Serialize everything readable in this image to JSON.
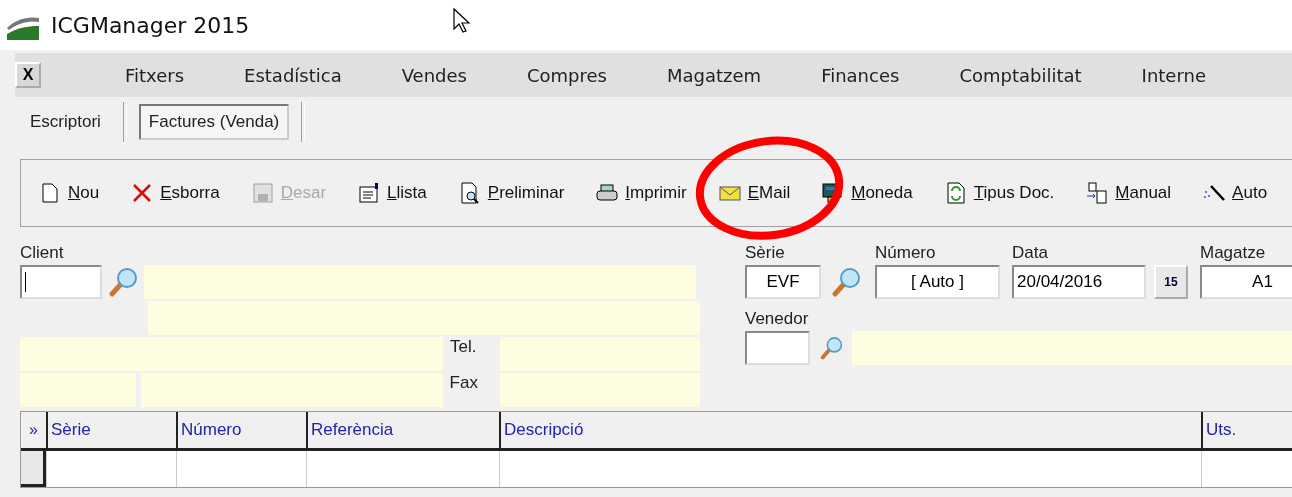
{
  "window": {
    "title": "ICGManager 2015"
  },
  "menu": {
    "close_label": "X",
    "items": [
      "Fitxers",
      "Estadística",
      "Vendes",
      "Compres",
      "Magatzem",
      "Finances",
      "Comptabilitat",
      "Interne"
    ]
  },
  "tabs": [
    {
      "label": "Escriptori",
      "selected": false
    },
    {
      "label": "Factures  (Venda)",
      "selected": true
    }
  ],
  "toolbar": [
    {
      "label": "Nou",
      "kind": "new",
      "disabled": false
    },
    {
      "label": "Esborra",
      "kind": "delete",
      "disabled": false
    },
    {
      "label": "Desar",
      "kind": "save",
      "disabled": true
    },
    {
      "label": "Llista",
      "kind": "list",
      "disabled": false
    },
    {
      "label": "Preliminar",
      "kind": "preview",
      "disabled": false
    },
    {
      "label": "Imprimir",
      "kind": "print",
      "disabled": false
    },
    {
      "label": "EMail",
      "kind": "email",
      "disabled": false
    },
    {
      "label": "Moneda",
      "kind": "currency",
      "disabled": false
    },
    {
      "label": "Tipus Doc.",
      "kind": "doctype",
      "disabled": false
    },
    {
      "label": "Manual",
      "kind": "manual",
      "disabled": false
    },
    {
      "label": "Auto",
      "kind": "auto",
      "disabled": false
    }
  ],
  "client": {
    "label": "Client",
    "focused": true,
    "phone_label": "Tel.",
    "fax_label": "Fax"
  },
  "document_fields": [
    {
      "label": "Sèrie",
      "value": "EVF",
      "kind": "lookup"
    },
    {
      "label": "Número",
      "value": "[ Auto ]",
      "kind": "text"
    },
    {
      "label": "Data",
      "value": "20/04/2016",
      "kind": "date",
      "calendar_label": "15"
    },
    {
      "label": "Magatze",
      "value": "A1",
      "kind": "text"
    }
  ],
  "seller": {
    "label": "Venedor"
  },
  "grid": {
    "indicator": "»",
    "columns": [
      "Sèrie",
      "Número",
      "Referència",
      "Descripció",
      "Uts."
    ]
  },
  "annotation": {
    "kind": "ellipse"
  }
}
